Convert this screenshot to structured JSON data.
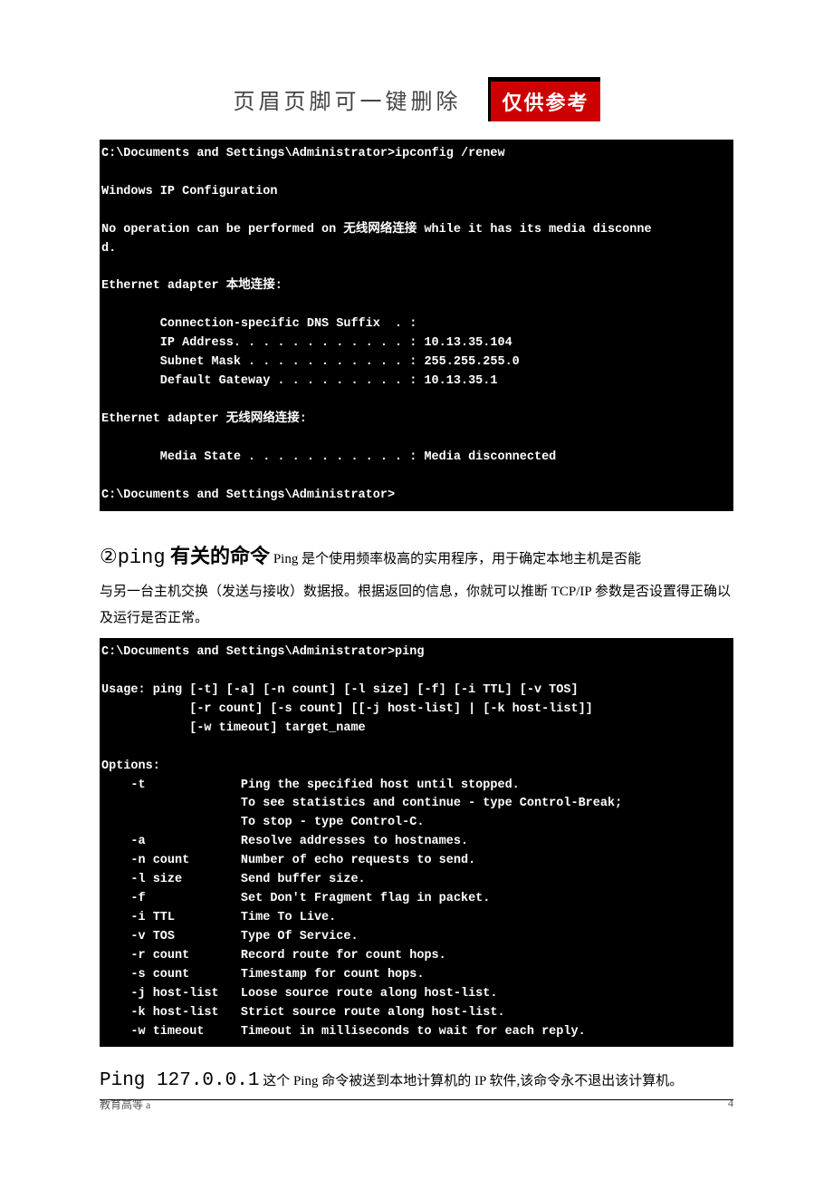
{
  "header": {
    "title": "页眉页脚可一键删除",
    "badge": "仅供参考"
  },
  "terminal1": "C:\\Documents and Settings\\Administrator>ipconfig /renew\n\nWindows IP Configuration\n\nNo operation can be performed on 无线网络连接 while it has its media disconne\nd.\n\nEthernet adapter 本地连接:\n\n        Connection-specific DNS Suffix  . :\n        IP Address. . . . . . . . . . . . : 10.13.35.104\n        Subnet Mask . . . . . . . . . . . : 255.255.255.0\n        Default Gateway . . . . . . . . . : 10.13.35.1\n\nEthernet adapter 无线网络连接:\n\n        Media State . . . . . . . . . . . : Media disconnected\n\nC:\\Documents and Settings\\Administrator>",
  "section": {
    "num": "②",
    "mono": "ping",
    "title": " 有关的命令",
    "intro_inline": "   Ping 是个使用频率极高的实用程序，用于确定本地主机是否能",
    "intro_rest": "与另一台主机交换（发送与接收）数据报。根据返回的信息，你就可以推断 TCP/IP 参数是否设置得正确以及运行是否正常。"
  },
  "terminal2": "C:\\Documents and Settings\\Administrator>ping\n\nUsage: ping [-t] [-a] [-n count] [-l size] [-f] [-i TTL] [-v TOS]\n            [-r count] [-s count] [[-j host-list] | [-k host-list]]\n            [-w timeout] target_name\n\nOptions:\n    -t             Ping the specified host until stopped.\n                   To see statistics and continue - type Control-Break;\n                   To stop - type Control-C.\n    -a             Resolve addresses to hostnames.\n    -n count       Number of echo requests to send.\n    -l size        Send buffer size.\n    -f             Set Don't Fragment flag in packet.\n    -i TTL         Time To Live.\n    -v TOS         Type Of Service.\n    -r count       Record route for count hops.\n    -s count       Timestamp for count hops.\n    -j host-list   Loose source route along host-list.\n    -k host-list   Strict source route along host-list.\n    -w timeout     Timeout in milliseconds to wait for each reply.\n",
  "ping": {
    "cmd": "Ping  127.0.0.1",
    "desc": " 这个 Ping 命令被送到本地计算机的 IP 软件,该命令永不退出该计算机。"
  },
  "footer": {
    "left": "教育高等 a",
    "right": "4"
  }
}
